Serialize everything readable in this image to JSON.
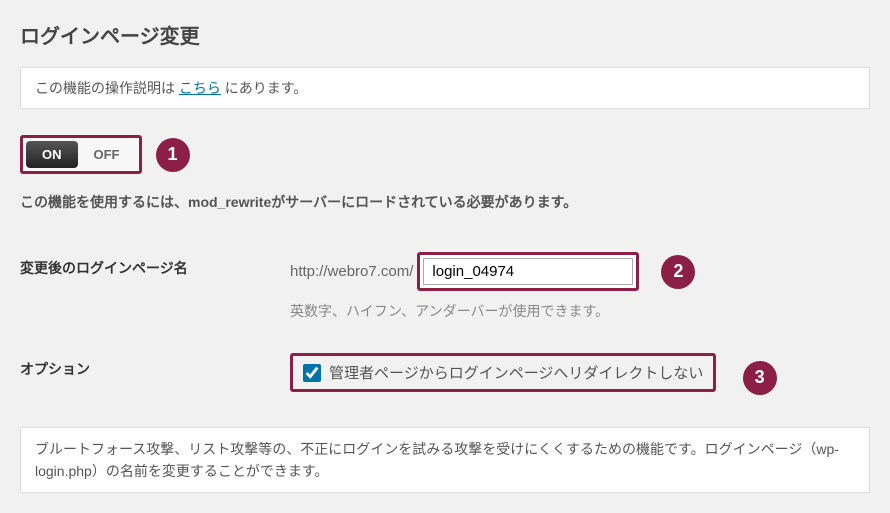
{
  "page_title": "ログインページ変更",
  "notice": {
    "prefix": "この機能の操作説明は ",
    "link": "こちら",
    "suffix": " にあります。"
  },
  "toggle": {
    "on": "ON",
    "off": "OFF"
  },
  "markers": {
    "one": "1",
    "two": "2",
    "three": "3"
  },
  "mod_note": "この機能を使用するには、mod_rewriteがサーバーにロードされている必要があります。",
  "login_page": {
    "label": "変更後のログインページ名",
    "url_prefix": "http://webro7.com/",
    "value": "login_04974",
    "hint": "英数字、ハイフン、アンダーバーが使用できます。"
  },
  "option": {
    "label": "オプション",
    "checkbox_label": "管理者ページからログインページへリダイレクトしない",
    "checked": true
  },
  "description": "ブルートフォース攻撃、リスト攻撃等の、不正にログインを試みる攻撃を受けにくくするための機能です。ログインページ（wp-login.php）の名前を変更することができます。"
}
